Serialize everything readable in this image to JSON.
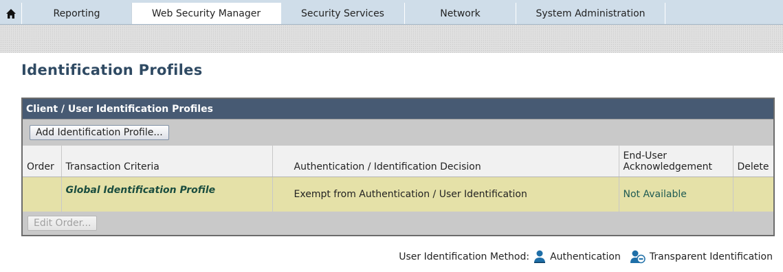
{
  "nav": {
    "tabs": [
      {
        "label": "Reporting",
        "active": false
      },
      {
        "label": "Web Security Manager",
        "active": true
      },
      {
        "label": "Security Services",
        "active": false
      },
      {
        "label": "Network",
        "active": false
      },
      {
        "label": "System Administration",
        "active": false
      }
    ]
  },
  "page": {
    "title": "Identification Profiles"
  },
  "panel": {
    "title": "Client / User Identification Profiles",
    "add_button": "Add Identification Profile...",
    "columns": {
      "order": "Order",
      "criteria": "Transaction Criteria",
      "decision": "Authentication / Identification Decision",
      "ack_line1": "End-User",
      "ack_line2": "Acknowledgement",
      "delete": "Delete"
    },
    "rows": [
      {
        "order": "",
        "criteria": "Global Identification Profile",
        "decision": "Exempt from Authentication / User Identification",
        "ack": "Not Available",
        "delete": ""
      }
    ],
    "edit_order_button": "Edit Order..."
  },
  "legend": {
    "label": "User Identification Method:",
    "auth": "Authentication",
    "transparent": "Transparent Identification"
  },
  "colors": {
    "nav_bg": "#cfdde9",
    "panel_header": "#475a73",
    "row_highlight": "#e5e1a8",
    "title": "#2f4a63",
    "icon_blue": "#1f6fa8"
  }
}
